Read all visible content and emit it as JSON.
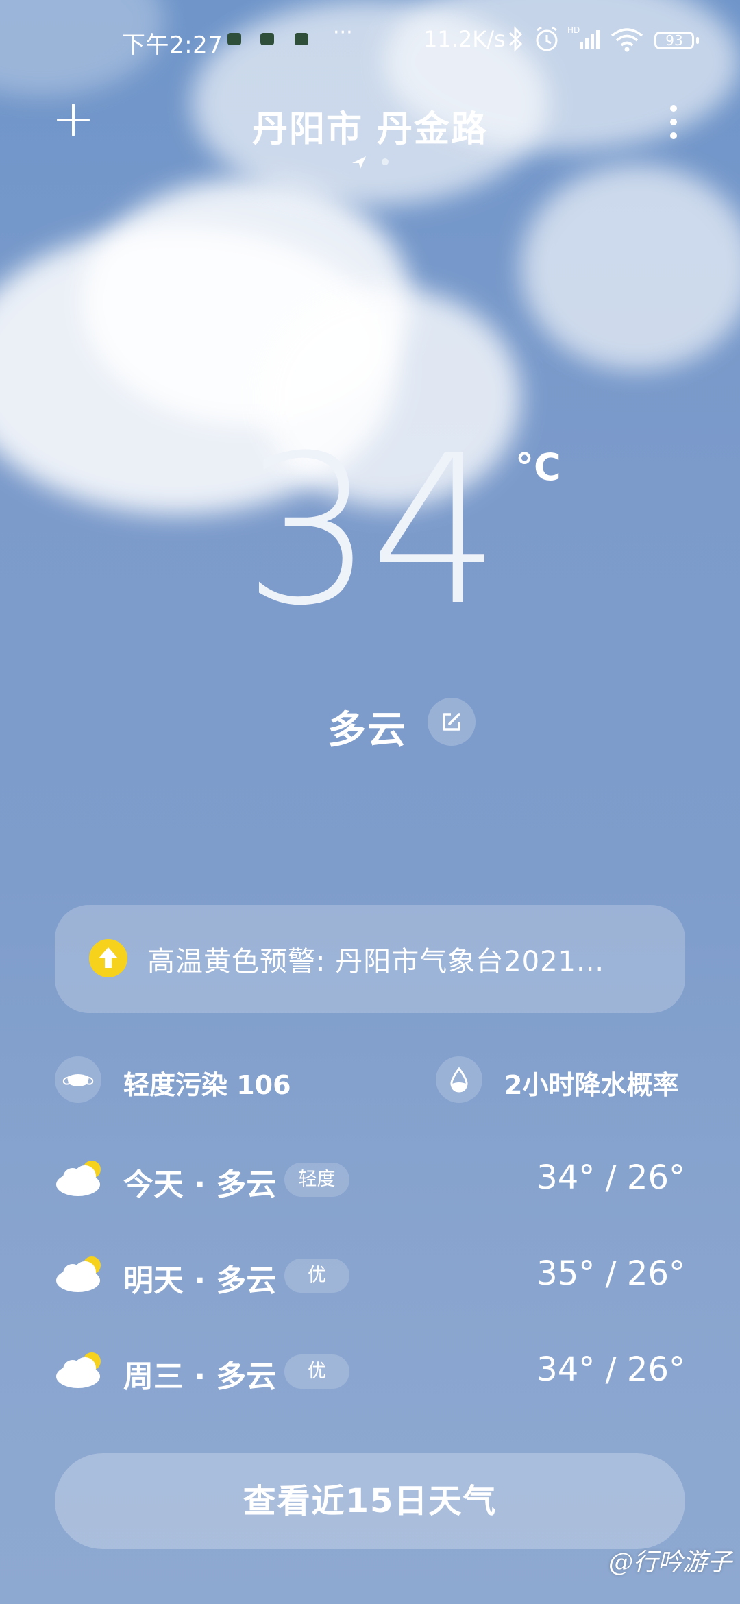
{
  "status_bar": {
    "time": "下午2:27",
    "dots": "···",
    "speed": "11.2K/s",
    "battery": "93"
  },
  "header": {
    "title": "丹阳市 丹金路"
  },
  "current": {
    "temperature": "34",
    "unit": "°C",
    "condition": "多云"
  },
  "alert": {
    "text": "高温黄色预警: 丹阳市气象台2021...",
    "icon": "up-arrow-icon",
    "color": "#f6d21d"
  },
  "info": {
    "air_quality": "轻度污染 106",
    "rain": "2小时降水概率"
  },
  "forecast": [
    {
      "label": "今天 · 多云",
      "badge": "轻度",
      "temp": "34° / 26°"
    },
    {
      "label": "明天 · 多云",
      "badge": "优",
      "temp": "35° / 26°"
    },
    {
      "label": "周三 · 多云",
      "badge": "优",
      "temp": "34° / 26°"
    }
  ],
  "button": {
    "label": "查看近15日天气"
  },
  "watermark": "@行吟游子"
}
